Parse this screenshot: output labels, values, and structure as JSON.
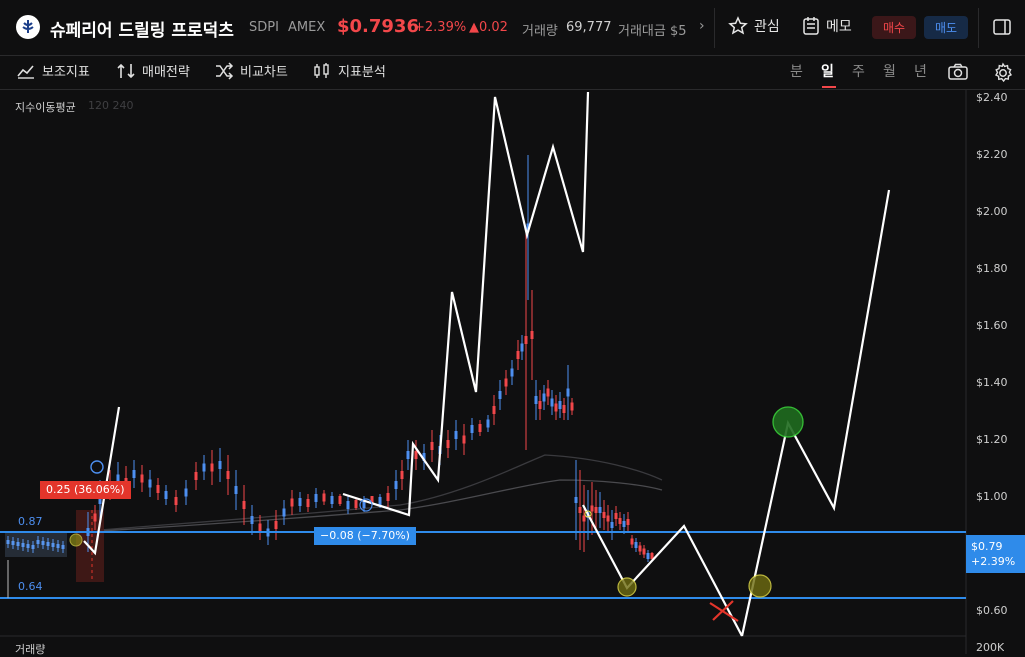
{
  "header": {
    "name": "슈페리어 드릴링 프로덕츠",
    "symbol": "SDPI",
    "exchange": "AMEX",
    "price": "$0.7936",
    "change_pct": "+2.39%",
    "change_abs": "▲0.02",
    "volume_label": "거래량",
    "volume_value": "69,777",
    "amount_label": "거래대금 $5",
    "fav_label": "관심",
    "memo_label": "메모",
    "buy_label": "매수",
    "sell_label": "매도"
  },
  "toolbar": {
    "items": [
      "보조지표",
      "매매전략",
      "비교차트",
      "지표분석"
    ],
    "timeframes": [
      "분",
      "일",
      "주",
      "월",
      "년"
    ],
    "active_timeframe": "일"
  },
  "indicator": {
    "title": "지수이동평균",
    "params": "120 240"
  },
  "axis": {
    "labels": [
      "$2.40",
      "$2.20",
      "$2.00",
      "$1.80",
      "$1.60",
      "$1.40",
      "$1.20",
      "$1.00",
      "$0.60"
    ],
    "current_price": "$0.79",
    "current_change": "+2.39%"
  },
  "levels": {
    "upper": "0.87",
    "lower": "0.64"
  },
  "annotations": {
    "red_tag": "0.25 (36.06%)",
    "blue_tag": "−0.08 (−7.70%)"
  },
  "volume_pane": {
    "title": "거래량",
    "axis_label": "200K"
  },
  "colors": {
    "up": "#f2474a",
    "down": "#4d8ff0",
    "level": "#2f8bea",
    "background": "#0f0f10"
  }
}
